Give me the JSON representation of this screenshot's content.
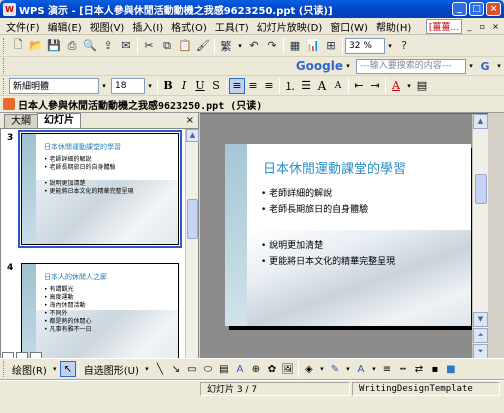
{
  "window": {
    "title": "WPS 演示 - [日本人參與休閒活動動機之我感9623250.ppt (只读)]"
  },
  "menu": {
    "items": [
      "文件(F)",
      "编辑(E)",
      "视图(V)",
      "插入(I)",
      "格式(O)",
      "工具(T)",
      "幻灯片放映(D)",
      "窗口(W)",
      "帮助(H)"
    ],
    "help_badge": "[薑薑..."
  },
  "toolbar": {
    "zoom": "32 %",
    "google": "Google",
    "search_placeholder": "---输入要搜索的内容---"
  },
  "format": {
    "font_name": "新細明體",
    "font_size": "18",
    "bold": "B",
    "italic": "I",
    "underline": "U",
    "strike": "S",
    "font_size_label": "A"
  },
  "document": {
    "title": "日本人參與休閒活動動機之我感9623250.ppt (只读)"
  },
  "panel": {
    "tabs": [
      "大綱",
      "幻灯片"
    ],
    "close": "×"
  },
  "thumbnails": [
    {
      "number": "3",
      "title": "日本休閒運動課堂的學習",
      "bullets": [
        "老師詳細的解說",
        "老師長期旅日的自身體驗",
        "",
        "說明更加清楚",
        "更能將日本文化的精華完整呈現"
      ]
    },
    {
      "number": "4",
      "title": "日本人的休閒人之廊",
      "bullets": [
        "有謂觀光",
        "高度運動",
        "海內休閒活動",
        "不同外",
        "都是熱的休閒心",
        "凡事有雅不一日"
      ]
    }
  ],
  "slide": {
    "title": "日本休閒運動課堂的學習",
    "bullets_group1": [
      "老師詳細的解說",
      "老師長期旅日的自身體驗"
    ],
    "bullets_group2": [
      "說明更加清楚",
      "更能將日本文化的精華完整呈現"
    ]
  },
  "drawing": {
    "label": "绘图(R)",
    "autoshape": "自选图形(U)"
  },
  "status": {
    "slide": "幻灯片 3 / 7",
    "template": "WritingDesignTemplate"
  },
  "colors": {
    "titlebar": "#0046c8",
    "slide_title": "#2a8fc8",
    "selection": "#2a58c8"
  }
}
